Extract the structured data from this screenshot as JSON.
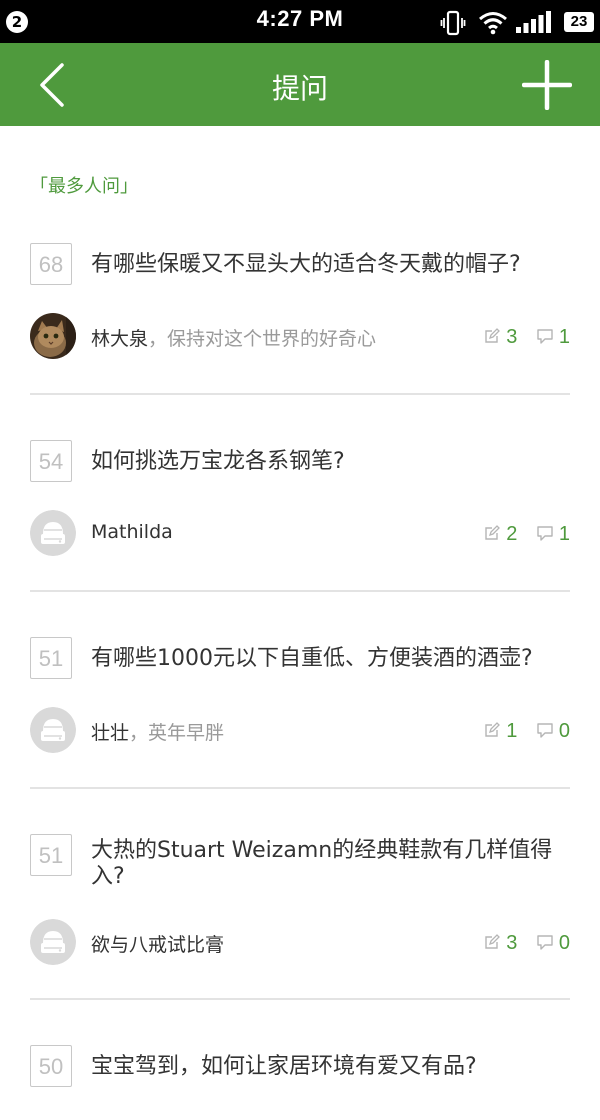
{
  "status_bar": {
    "notification_count": "2",
    "time": "4:27 PM",
    "battery": "23"
  },
  "header": {
    "title": "提问"
  },
  "section": {
    "label": "「最多人问」"
  },
  "questions": [
    {
      "count": "68",
      "title": "有哪些保暖又不显头大的适合冬天戴的帽子?",
      "author": "林大泉",
      "separator": "，",
      "bio": "保持对这个世界的好奇心",
      "answers": "3",
      "comments": "1",
      "avatar": "cat-photo"
    },
    {
      "count": "54",
      "title": "如何挑选万宝龙各系钢笔?",
      "author": "Mathilda",
      "separator": "",
      "bio": "",
      "answers": "2",
      "comments": "1",
      "avatar": "default"
    },
    {
      "count": "51",
      "title": "有哪些1000元以下自重低、方便装酒的酒壶?",
      "author": "壮壮",
      "separator": "，",
      "bio": "英年早胖",
      "answers": "1",
      "comments": "0",
      "avatar": "default"
    },
    {
      "count": "51",
      "title": "大热的Stuart Weizamn的经典鞋款有几样值得入?",
      "author": "欲与八戒试比膏",
      "separator": "",
      "bio": "",
      "answers": "3",
      "comments": "0",
      "avatar": "default"
    },
    {
      "count": "50",
      "title": "宝宝驾到，如何让家居环境有爱又有品?",
      "author": "",
      "separator": "",
      "bio": "",
      "answers": "",
      "comments": "",
      "avatar": "default"
    }
  ],
  "colors": {
    "header_bg": "#4f9a3d",
    "accent": "#4f9a3d"
  },
  "icons": {
    "back": "chevron-left-icon",
    "add": "plus-icon",
    "answers": "edit-icon",
    "comments": "comment-icon"
  }
}
